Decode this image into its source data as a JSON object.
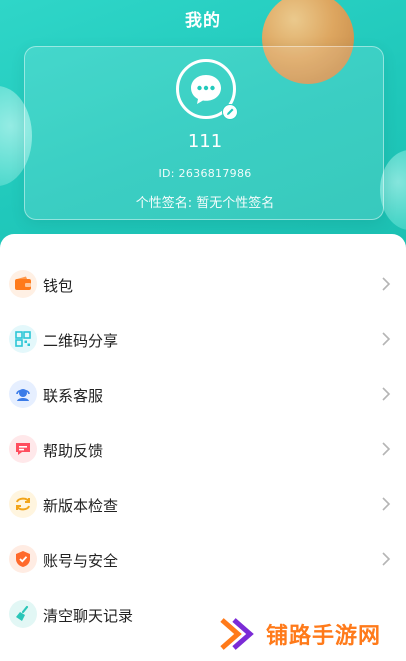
{
  "header": {
    "title": "我的",
    "colors": {
      "teal": "#22cabc",
      "white": "#ffffff"
    }
  },
  "profile": {
    "avatar_icon": "chat-bubble-icon",
    "edit_icon": "edit-pencil-icon",
    "username": "111",
    "id_line": "ID:  2636817986",
    "signature": "个性签名:  暂无个性签名"
  },
  "menu": {
    "items": [
      {
        "label": "钱包",
        "icon": "wallet-icon",
        "color": "#ff7a1a",
        "bg": "#fff0e4"
      },
      {
        "label": "二维码分享",
        "icon": "qrcode-icon",
        "color": "#2cc6d6",
        "bg": "#e4f8fb"
      },
      {
        "label": "联系客服",
        "icon": "customer-service-icon",
        "color": "#3a7be8",
        "bg": "#e6efff"
      },
      {
        "label": "帮助反馈",
        "icon": "feedback-icon",
        "color": "#ff4d5e",
        "bg": "#ffe8ea"
      },
      {
        "label": "新版本检查",
        "icon": "update-icon",
        "color": "#f2a51a",
        "bg": "#fff5df"
      },
      {
        "label": "账号与安全",
        "icon": "shield-icon",
        "color": "#ff6a2c",
        "bg": "#ffece3"
      },
      {
        "label": "清空聊天记录",
        "icon": "broom-icon",
        "color": "#2bc6b8",
        "bg": "#e2f7f5"
      }
    ]
  },
  "watermark": {
    "text": "铺路手游网",
    "icon": "double-chevron-logo-icon",
    "color": "#ff7a1a"
  }
}
